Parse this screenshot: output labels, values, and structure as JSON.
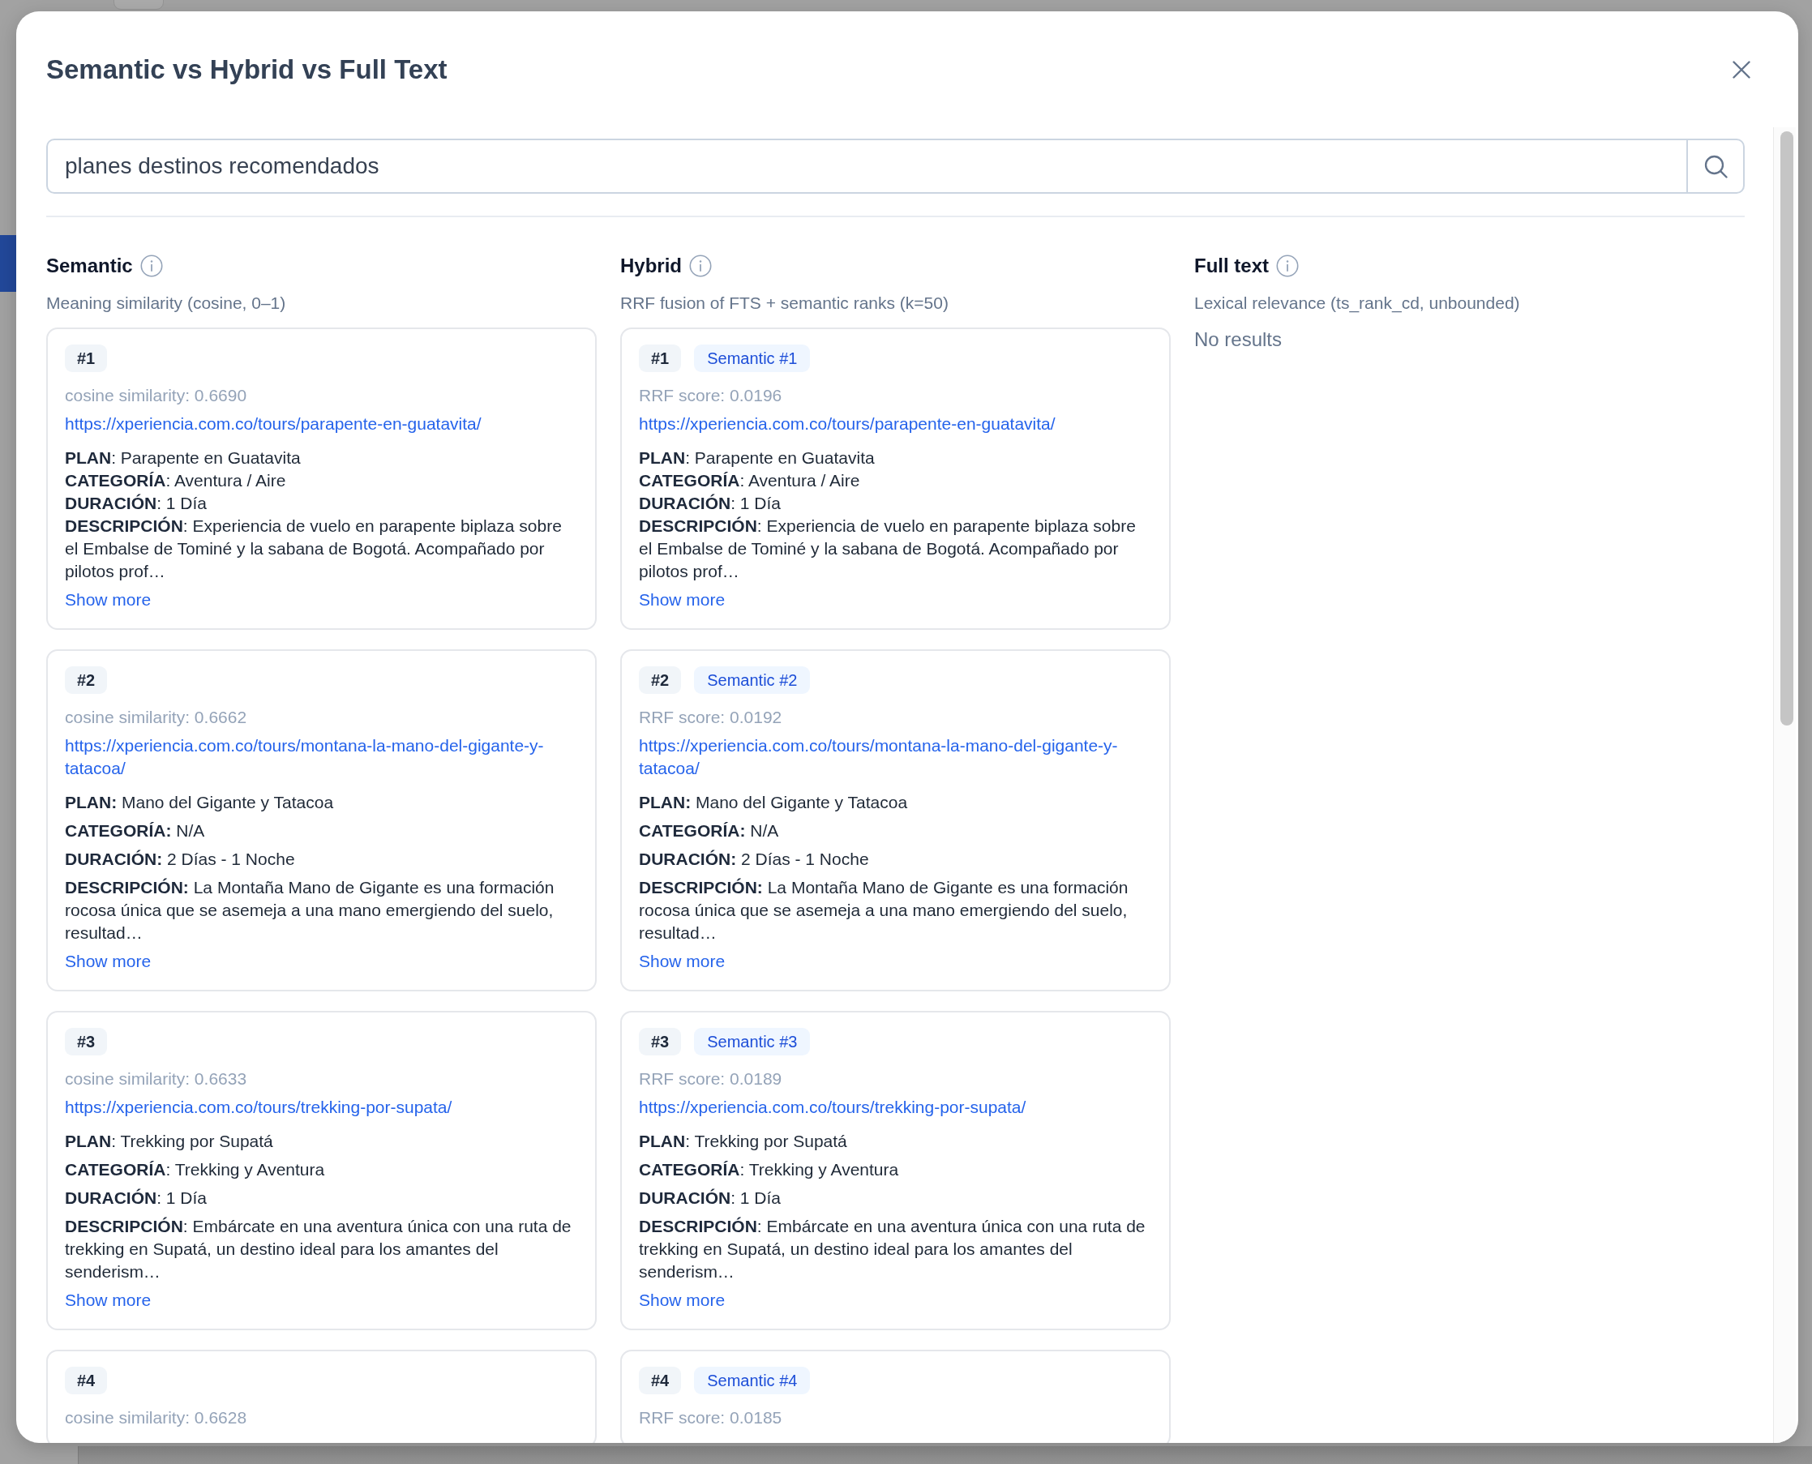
{
  "dialog": {
    "title": "Semantic vs Hybrid vs Full Text"
  },
  "search": {
    "value": "planes destinos recomendados"
  },
  "columns": [
    {
      "title": "Semantic",
      "subtitle": "Meaning similarity (cosine, 0–1)",
      "results": [
        {
          "kind": "lines",
          "rank": "#1",
          "score": "cosine similarity: 0.6690",
          "url": "https://xperiencia.com.co/tours/parapente-en-guatavita/",
          "fields": [
            "**PLAN**: Parapente en Guatavita",
            "**CATEGORÍA**: Aventura / Aire",
            "**DURACIÓN**: 1 Día",
            "**DESCRIPCIÓN**: Experiencia de vuelo en parapente biplaza sobre el Embalse de Tominé y la sabana de Bogotá. Acompañado por pilotos prof…"
          ],
          "link": "Show more"
        },
        {
          "kind": "paragraphs",
          "rank": "#2",
          "score": "cosine similarity: 0.6662",
          "url": "https://xperiencia.com.co/tours/montana-la-mano-del-gigante-y-tatacoa/",
          "fields": [
            "**PLAN:** Mano del Gigante y Tatacoa",
            "**CATEGORÍA:** N/A",
            "**DURACIÓN:** 2 Días - 1 Noche",
            "**DESCRIPCIÓN:** La Montaña Mano de Gigante es una formación rocosa única que se asemeja a una mano emergiendo del suelo, resultad…"
          ],
          "link": "Show more"
        },
        {
          "kind": "paragraphs",
          "rank": "#3",
          "score": "cosine similarity: 0.6633",
          "url": "https://xperiencia.com.co/tours/trekking-por-supata/",
          "fields": [
            "**PLAN**: Trekking por Supatá",
            "**CATEGORÍA**: Trekking y Aventura",
            "**DURACIÓN**: 1 Día",
            "**DESCRIPCIÓN**: Embárcate en una aventura única con una ruta de trekking en Supatá, un destino ideal para los amantes del senderism…"
          ],
          "link": "Show more"
        },
        {
          "rank": "#4",
          "score": "cosine similarity: 0.6628"
        }
      ]
    },
    {
      "title": "Hybrid",
      "subtitle": "RRF fusion of FTS + semantic ranks (k=50)",
      "results": [
        {
          "kind": "lines",
          "rank": "#1",
          "tag": "Semantic #1",
          "score": "RRF score: 0.0196",
          "url": "https://xperiencia.com.co/tours/parapente-en-guatavita/",
          "fields": [
            "**PLAN**: Parapente en Guatavita",
            "**CATEGORÍA**: Aventura / Aire",
            "**DURACIÓN**: 1 Día",
            "**DESCRIPCIÓN**: Experiencia de vuelo en parapente biplaza sobre el Embalse de Tominé y la sabana de Bogotá. Acompañado por pilotos prof…"
          ],
          "link": "Show more"
        },
        {
          "kind": "paragraphs",
          "rank": "#2",
          "tag": "Semantic #2",
          "score": "RRF score: 0.0192",
          "url": "https://xperiencia.com.co/tours/montana-la-mano-del-gigante-y-tatacoa/",
          "fields": [
            "**PLAN:** Mano del Gigante y Tatacoa",
            "**CATEGORÍA:** N/A",
            "**DURACIÓN:** 2 Días - 1 Noche",
            "**DESCRIPCIÓN:** La Montaña Mano de Gigante es una formación rocosa única que se asemeja a una mano emergiendo del suelo, resultad…"
          ],
          "link": "Show more"
        },
        {
          "kind": "paragraphs",
          "rank": "#3",
          "tag": "Semantic #3",
          "score": "RRF score: 0.0189",
          "url": "https://xperiencia.com.co/tours/trekking-por-supata/",
          "fields": [
            "**PLAN**: Trekking por Supatá",
            "**CATEGORÍA**: Trekking y Aventura",
            "**DURACIÓN**: 1 Día",
            "**DESCRIPCIÓN**: Embárcate en una aventura única con una ruta de trekking en Supatá, un destino ideal para los amantes del senderism…"
          ],
          "link": "Show more"
        },
        {
          "rank": "#4",
          "tag": "Semantic #4",
          "score": "RRF score: 0.0185"
        }
      ]
    },
    {
      "title": "Full text",
      "subtitle": "Lexical relevance (ts_rank_cd, unbounded)",
      "empty_message": "No results"
    }
  ]
}
